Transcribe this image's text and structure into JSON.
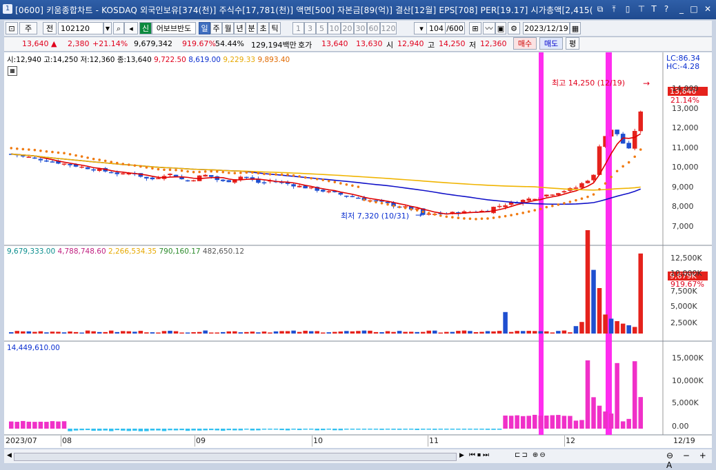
{
  "titlebar": {
    "number": "1",
    "title": "[0600] 키움종합차트 - KOSDAQ 외국인보유[374(천)] 주식수[17,781(천)] 액면[500] 자본금[89(억)] 결산[12월] EPS[708] PER[19.17] 시가총액[2,415("
  },
  "toolbar": {
    "period_label": "주",
    "jeon_label": "전",
    "code": "102120",
    "new_label": "신",
    "stock_name": "어보브반도",
    "periods": [
      "일",
      "주",
      "월",
      "년",
      "분",
      "초",
      "틱"
    ],
    "selected_period": "일",
    "intervals": [
      "1",
      "3",
      "5",
      "10",
      "20",
      "30",
      "60",
      "120"
    ],
    "count": "104",
    "count_total": "/600",
    "date": "2023/12/19"
  },
  "quote": {
    "price": "13,640",
    "change": "2,380",
    "change_pct": "+21.14%",
    "volume": "9,679,342",
    "volume_ratio": "919.67%",
    "pct2": "54.44%",
    "amount": "129,194백만",
    "hoga_label": "호가",
    "ask": "13,640",
    "bid": "13,630",
    "open_label": "시",
    "open": "12,940",
    "high_label": "고",
    "high": "14,250",
    "low_label": "저",
    "low": "12,360",
    "buy_label": "매수",
    "sell_label": "매도",
    "avg_label": "평"
  },
  "price_pane": {
    "ohlc_text": "시:12,940 고:14,250 저:12,360 종:13,640",
    "ma1": "9,722.50",
    "ma2": "8,619.00",
    "ma3": "9,229.33",
    "ma4": "9,893.40",
    "lc": "LC:86.34",
    "hc": "HC:-4.28",
    "high_annot": "최고 14,250 (12/19)",
    "low_annot": "최저 7,320 (10/31)",
    "current_tag": "13,640",
    "pct_tag": "21.14%",
    "y_labels": [
      "14,000",
      "13,000",
      "12,000",
      "11,000",
      "10,000",
      "9,000",
      "8,000",
      "7,000"
    ]
  },
  "volume_pane": {
    "v1": "9,679,333.00",
    "v2": "4,788,748.60",
    "v3": "2,266,534.35",
    "v4": "790,160.17",
    "v5": "482,650.12",
    "current_tag": "9,679K",
    "pct_tag": "919.67%",
    "y_labels": [
      "12,500K",
      "10,000K",
      "7,500K",
      "5,000K",
      "2,500K"
    ]
  },
  "third_pane": {
    "value": "14,449,610.00",
    "y_labels": [
      "15,000K",
      "10,000K",
      "5,000K",
      "0.00"
    ]
  },
  "x_labels": [
    "2023/07",
    "08",
    "09",
    "10",
    "11",
    "12",
    "12/19"
  ],
  "colors": {
    "up": "#e5221c",
    "down": "#1f4fd0",
    "highlight": "#ff22ee",
    "ma_red": "#e00000",
    "ma_blue": "#1010c8",
    "ma_gold": "#f0b400",
    "ma_orange": "#f07a10"
  },
  "chart_data": {
    "type": "candlestick",
    "series": [
      {
        "name": "ma1",
        "values": []
      },
      {
        "name": "ma2",
        "values": []
      }
    ],
    "ylim": [
      6000,
      14700
    ]
  }
}
